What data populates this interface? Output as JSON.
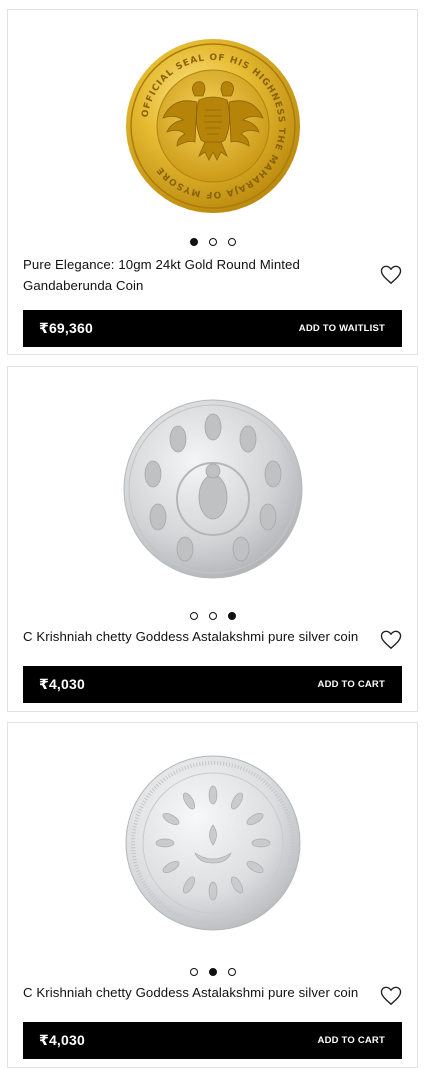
{
  "products": [
    {
      "title": "Pure Elegance: 10gm 24kt Gold Round Minted Gandaberunda Coin",
      "price": "₹69,360",
      "action_label": "ADD TO WAITLIST",
      "coin_inscription": "OFFICIAL SEAL OF HIS HIGHNESS THE MAHARAJA OF MYSORE",
      "carousel": {
        "count": 3,
        "active": 1
      }
    },
    {
      "title": "C Krishniah chetty Goddess Astalakshmi pure silver coin",
      "price": "₹4,030",
      "action_label": "ADD TO CART",
      "carousel": {
        "count": 3,
        "active": 3
      }
    },
    {
      "title": "C Krishniah chetty Goddess Astalakshmi pure silver coin",
      "price": "₹4,030",
      "action_label": "ADD TO CART",
      "carousel": {
        "count": 3,
        "active": 2
      }
    }
  ],
  "icons": {
    "wishlist": "heart-outline-icon"
  },
  "colors": {
    "bar": "#000000",
    "gold": "#d9a91c",
    "silver": "#c9cbcd"
  }
}
